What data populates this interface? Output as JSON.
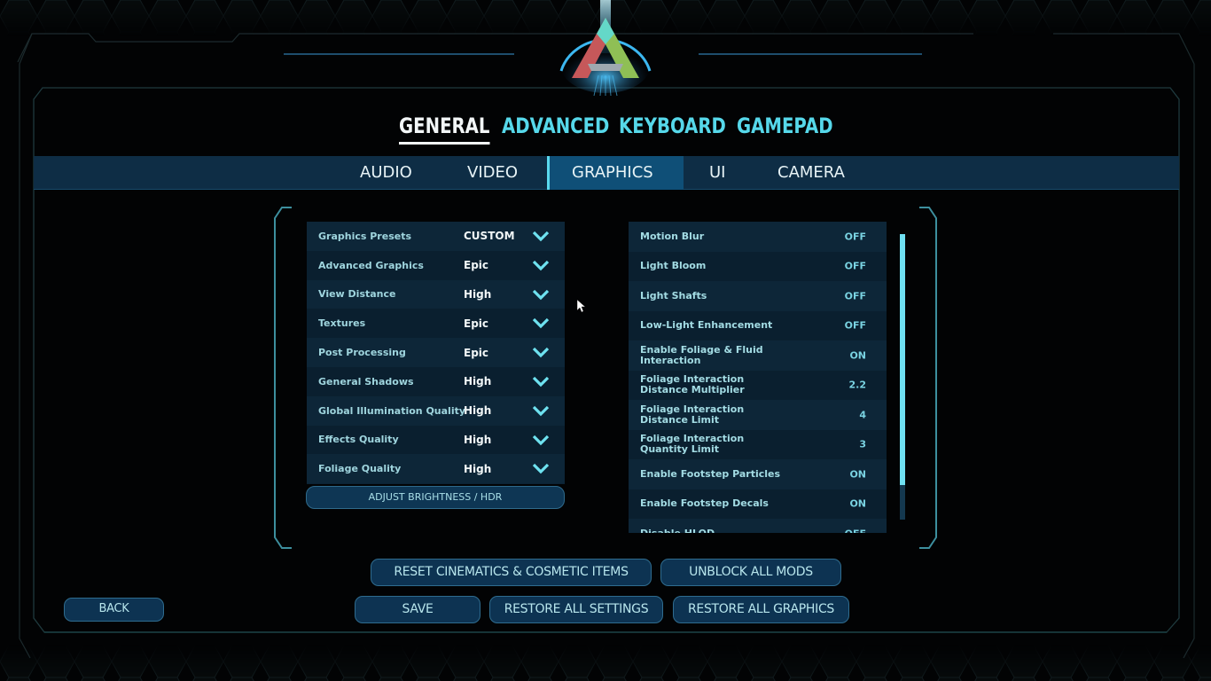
{
  "main_tabs": [
    {
      "label": "GENERAL",
      "active": true
    },
    {
      "label": "ADVANCED",
      "active": false
    },
    {
      "label": "KEYBOARD",
      "active": false
    },
    {
      "label": "GAMEPAD",
      "active": false
    }
  ],
  "sub_tabs": [
    {
      "label": "AUDIO",
      "active": false
    },
    {
      "label": "VIDEO",
      "active": false
    },
    {
      "label": "GRAPHICS",
      "active": true
    },
    {
      "label": "UI",
      "active": false
    },
    {
      "label": "CAMERA",
      "active": false
    }
  ],
  "left_panel": {
    "rows": [
      {
        "label": "Graphics Presets",
        "value": "CUSTOM"
      },
      {
        "label": "Advanced Graphics",
        "value": "Epic"
      },
      {
        "label": "View Distance",
        "value": "High"
      },
      {
        "label": "Textures",
        "value": "Epic"
      },
      {
        "label": "Post Processing",
        "value": "Epic"
      },
      {
        "label": "General Shadows",
        "value": "High"
      },
      {
        "label": "Global Illumination Quality",
        "value": "High"
      },
      {
        "label": "Effects Quality",
        "value": "High"
      },
      {
        "label": "Foliage Quality",
        "value": "High"
      }
    ],
    "brightness_button": "ADJUST BRIGHTNESS / HDR"
  },
  "right_panel": {
    "rows": [
      {
        "label": "Motion Blur",
        "value": "OFF"
      },
      {
        "label": "Light Bloom",
        "value": "OFF"
      },
      {
        "label": "Light Shafts",
        "value": "OFF"
      },
      {
        "label": "Low-Light Enhancement",
        "value": "OFF"
      },
      {
        "label": "Enable Foliage & Fluid Interaction",
        "value": "ON"
      },
      {
        "label": "Foliage Interaction Distance Multiplier",
        "value": "2.2"
      },
      {
        "label": "Foliage Interaction Distance Limit",
        "value": "4"
      },
      {
        "label": "Foliage Interaction Quantity Limit",
        "value": "3"
      },
      {
        "label": "Enable Footstep Particles",
        "value": "ON"
      },
      {
        "label": "Enable Footstep Decals",
        "value": "ON"
      },
      {
        "label": "Disable HLOD",
        "value": "OFF"
      }
    ],
    "scroll_position_fraction": 0.0,
    "scroll_visible_fraction": 0.88
  },
  "buttons": {
    "reset_cinematics": "RESET CINEMATICS & COSMETIC ITEMS",
    "unblock_mods": "UNBLOCK ALL MODS",
    "save": "SAVE",
    "restore_settings": "RESTORE ALL SETTINGS",
    "restore_graphics": "RESTORE ALL GRAPHICS",
    "back": "BACK"
  },
  "icons": {
    "logo": "ark-logo",
    "dropdown": "chevron-down-icon",
    "cursor": "mouse-pointer-icon"
  },
  "colors": {
    "accent": "#56d8ea",
    "active_tab_text": "#f2f6f7",
    "sub_bar_bg": "#0e2d45",
    "sub_tab_active_bg": "#0f4f77",
    "panel_bg": "#0b2233",
    "button_bg": "#0d3352",
    "frame_line": "#2b8f9a"
  }
}
